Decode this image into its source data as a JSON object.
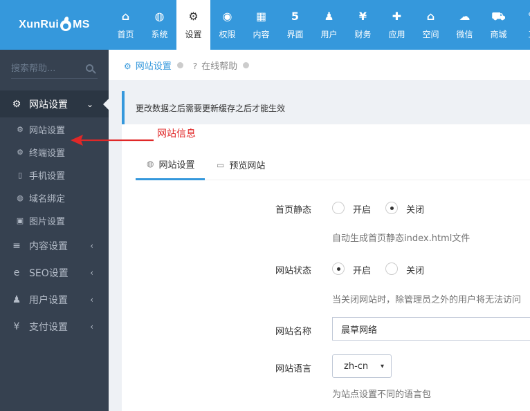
{
  "app": {
    "logo_text_left": "XunRui",
    "logo_text_right": "MS"
  },
  "topnav": [
    {
      "label": "首页",
      "icon": "home-icon",
      "glyph": "⌂"
    },
    {
      "label": "系统",
      "icon": "globe-icon",
      "glyph": "◍"
    },
    {
      "label": "设置",
      "icon": "gears-icon",
      "glyph": "⚙",
      "active": true
    },
    {
      "label": "权限",
      "icon": "user-circle-icon",
      "glyph": "◉"
    },
    {
      "label": "内容",
      "icon": "grid-icon",
      "glyph": "▦"
    },
    {
      "label": "界面",
      "icon": "html5-icon",
      "glyph": "5"
    },
    {
      "label": "用户",
      "icon": "user-icon",
      "glyph": "♟"
    },
    {
      "label": "财务",
      "icon": "yen-icon",
      "glyph": "¥"
    },
    {
      "label": "应用",
      "icon": "puzzle-icon",
      "glyph": "✚"
    },
    {
      "label": "空间",
      "icon": "home-icon",
      "glyph": "⌂"
    },
    {
      "label": "微信",
      "icon": "wechat-icon",
      "glyph": "☁"
    },
    {
      "label": "商城",
      "icon": "cart-icon",
      "glyph": "⛟"
    },
    {
      "label": "工",
      "icon": "tool-icon",
      "glyph": "✎"
    }
  ],
  "sidebar": {
    "search_placeholder": "搜索帮助...",
    "open_menu": {
      "label": "网站设置",
      "icon": "gear-icon",
      "glyph": "⚙",
      "arrow": "⌄"
    },
    "sub_items": [
      {
        "label": "网站设置",
        "icon": "gear-icon",
        "glyph": "⚙"
      },
      {
        "label": "终端设置",
        "icon": "gears-icon",
        "glyph": "⚙"
      },
      {
        "label": "手机设置",
        "icon": "mobile-icon",
        "glyph": "▯"
      },
      {
        "label": "域名绑定",
        "icon": "globe-icon",
        "glyph": "◍"
      },
      {
        "label": "图片设置",
        "icon": "image-icon",
        "glyph": "▣"
      }
    ],
    "menus": [
      {
        "label": "内容设置",
        "icon": "list-icon",
        "glyph": "≡",
        "arrow": "‹"
      },
      {
        "label": "SEO设置",
        "icon": "ie-icon",
        "glyph": "e",
        "arrow": "‹"
      },
      {
        "label": "用户设置",
        "icon": "user-icon",
        "glyph": "♟",
        "arrow": "‹"
      },
      {
        "label": "支付设置",
        "icon": "yen-icon",
        "glyph": "¥",
        "arrow": "‹"
      }
    ]
  },
  "breadcrumb": {
    "item1": "网站设置",
    "item2": "在线帮助"
  },
  "notice": "更改数据之后需要更新缓存之后才能生效",
  "annotation": "网站信息",
  "tabs": [
    {
      "label": "网站设置",
      "icon": "globe-icon",
      "glyph": "◍"
    },
    {
      "label": "预览网站",
      "icon": "monitor-icon",
      "glyph": "▭"
    }
  ],
  "form": {
    "home_static": {
      "label": "首页静态",
      "opt_on": "开启",
      "opt_off": "关闭",
      "selected": "关闭",
      "help": "自动生成首页静态index.html文件"
    },
    "site_status": {
      "label": "网站状态",
      "opt_on": "开启",
      "opt_off": "关闭",
      "selected": "开启",
      "help": "当关闭网站时，除管理员之外的用户将无法访问"
    },
    "site_name": {
      "label": "网站名称",
      "value": "晨草网络"
    },
    "site_lang": {
      "label": "网站语言",
      "value": "zh-cn",
      "help": "为站点设置不同的语言包"
    }
  }
}
